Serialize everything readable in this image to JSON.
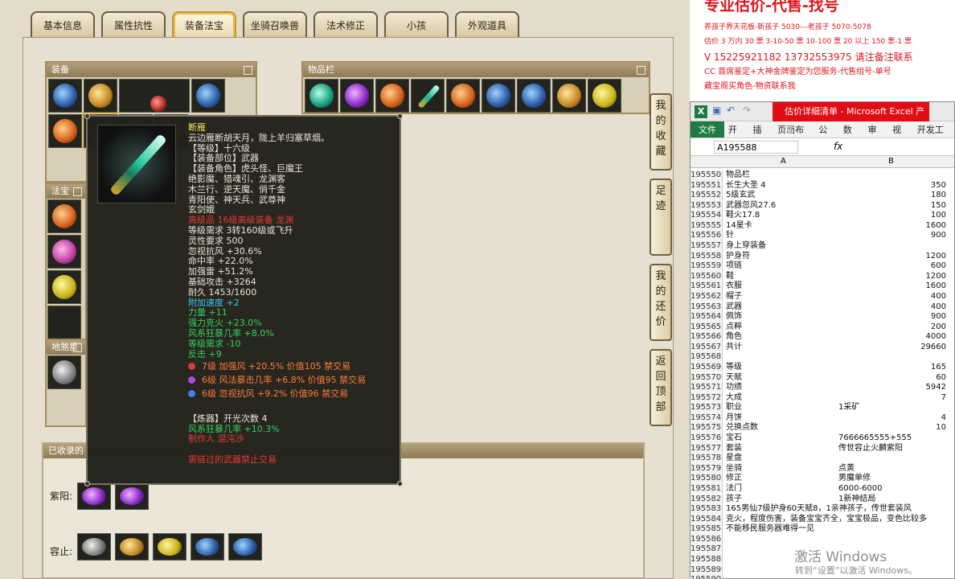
{
  "game": {
    "tabs": [
      {
        "label": "基本信息"
      },
      {
        "label": "属性抗性"
      },
      {
        "label": "装备法宝"
      },
      {
        "label": "坐骑召唤兽"
      },
      {
        "label": "法术修正"
      },
      {
        "label": "小孩"
      },
      {
        "label": "外观道具"
      }
    ],
    "active_tab_index": 2,
    "sections": {
      "equipment": "装备",
      "inventory": "物品栏",
      "treasure": "法宝",
      "earth": "地煞星的",
      "collected": "已收录的"
    },
    "side_buttons": [
      {
        "label": "我的收藏"
      },
      {
        "label": "足迹"
      },
      {
        "label": "我的还价"
      },
      {
        "label": "返回顶部"
      }
    ],
    "collected": {
      "row1_label": "紫阳:",
      "row2_label": "容止:"
    },
    "tooltip": {
      "name": "断雁",
      "desc": "云边雁断胡天月，陇上羊归塞草烟。",
      "level": "【等级】十六级",
      "slot": "【装备部位】武器",
      "roles1": "【装备角色】虎头怪、巨魔王",
      "roles2": "绝影魔、猎魂引、龙渊客",
      "roles3": "木兰行、逆天魔、俏千金",
      "roles4": "青阳使、神天兵、武尊神",
      "roles5": "玄剑娥",
      "warning1": "高级品 16级高级装备 龙渊",
      "req1": "等级需求 3转160级或飞升",
      "req2": "灵性要求 500",
      "stat1": "忽视抗风 +30.6%",
      "stat2": "命中率 +22.0%",
      "stat3": "加强雷 +51.2%",
      "stat4": "基础攻击 +3264",
      "stat5": "耐久 1453/1600",
      "stat6": "附加速度 +2",
      "stat7": "力量 +11",
      "stat8": "强力克火 +23.0%",
      "stat9": "风系狂暴几率 +8.0%",
      "stat10": "等级需求 -10",
      "stat11": "反击 +9",
      "gem1": "7级 加强风 +20.5% 价值105 禁交易",
      "gem2": "6级 风法暴击几率 +6.8% 价值95 禁交易",
      "gem3": "6级 忽视抗风 +9.2% 价值96 禁交易",
      "refine": "【炼器】开光次数 4",
      "refine_stat": "风系狂暴几率 +10.3%",
      "maker": "制作人 混沌沙",
      "footer": "需链过的武器禁止交易"
    }
  },
  "note": {
    "title": "专业估价-代售-找号",
    "line1": "养孩子界天花板-新孩子 5030---老孩子 5070-5078",
    "line2": "估价 3 万内 30 票 3-10-50 票 10-100 票 20 以上 150 票-1 票",
    "line3": "V 15225921182    13732553975   请注备注联系",
    "line4": "CC 首席鉴定+大神金牌鉴定为您服务-代售组号-单号",
    "line5": "藏宝阁买角色-物资联系我"
  },
  "excel": {
    "title": "估价详细清单 - Microsoft Excel 产品",
    "ribbon_tabs": [
      "文件",
      "开始",
      "插入",
      "页面布局",
      "公式",
      "数据",
      "审阅",
      "视图",
      "开发工具"
    ],
    "namebox": "A195588",
    "fx": "fx",
    "col_a": "A",
    "col_b": "B",
    "rows": [
      {
        "n": "195550",
        "a": "物品栏",
        "b": ""
      },
      {
        "n": "195551",
        "a": "长生大圣 4",
        "b": "350"
      },
      {
        "n": "195552",
        "a": "5级玄武",
        "b": "180"
      },
      {
        "n": "195553",
        "a": "武器忽风27.6",
        "b": "150"
      },
      {
        "n": "195554",
        "a": "鞋火17.8",
        "b": "100"
      },
      {
        "n": "195555",
        "a": "14星卡",
        "b": "1600"
      },
      {
        "n": "195556",
        "a": "针",
        "b": "900"
      },
      {
        "n": "195557",
        "a": "身上穿装备",
        "b": ""
      },
      {
        "n": "195558",
        "a": "护身符",
        "b": "1200"
      },
      {
        "n": "195559",
        "a": "项链",
        "b": "600"
      },
      {
        "n": "195560",
        "a": "鞋",
        "b": "1200"
      },
      {
        "n": "195561",
        "a": "衣服",
        "b": "1600"
      },
      {
        "n": "195562",
        "a": "帽子",
        "b": "400"
      },
      {
        "n": "195563",
        "a": "武器",
        "b": "400"
      },
      {
        "n": "195564",
        "a": "佩饰",
        "b": "900"
      },
      {
        "n": "195565",
        "a": "点粹",
        "b": "200"
      },
      {
        "n": "195566",
        "a": "角色",
        "b": "4000"
      },
      {
        "n": "195567",
        "a": "共计",
        "b": "29660"
      },
      {
        "n": "195568",
        "a": "",
        "b": ""
      },
      {
        "n": "195569",
        "a": "等级",
        "b": "165"
      },
      {
        "n": "195570",
        "a": "天赋",
        "b": "60"
      },
      {
        "n": "195571",
        "a": "功绩",
        "b": "5942"
      },
      {
        "n": "195572",
        "a": "大成",
        "b": "7"
      },
      {
        "n": "195573",
        "a": "职业",
        "b": "1采矿",
        "text": true
      },
      {
        "n": "195574",
        "a": "月饼",
        "b": "4"
      },
      {
        "n": "195575",
        "a": "兑换点数",
        "b": "10"
      },
      {
        "n": "195576",
        "a": "宝石",
        "b": "7666665555+555",
        "text": true
      },
      {
        "n": "195577",
        "a": "套装",
        "b": "传世容止火麟紫阳",
        "text": true
      },
      {
        "n": "195578",
        "a": "星盘",
        "b": ""
      },
      {
        "n": "195579",
        "a": "坐骑",
        "b": "点黄",
        "text": true
      },
      {
        "n": "195580",
        "a": "修正",
        "b": "男魔单修",
        "text": true
      },
      {
        "n": "195581",
        "a": "法门",
        "b": "6000-6000",
        "text": true
      },
      {
        "n": "195582",
        "a": "孩子",
        "b": "1新神结局",
        "text": true
      },
      {
        "n": "195583",
        "a": "165男仙7级护身60天赋8，1亲神孩子，传世套装风",
        "b": ""
      },
      {
        "n": "195584",
        "a": "克火，程度伤害，装备宝宝齐全，宝宝极品，变色比较多",
        "b": ""
      },
      {
        "n": "195585",
        "a": "不能移民服务器难得一见",
        "b": ""
      },
      {
        "n": "195586",
        "a": "",
        "b": ""
      },
      {
        "n": "195587",
        "a": "",
        "b": ""
      },
      {
        "n": "195588",
        "a": "",
        "b": ""
      },
      {
        "n": "195589",
        "a": "",
        "b": ""
      },
      {
        "n": "195590",
        "a": "",
        "b": ""
      }
    ]
  },
  "watermark": {
    "line1": "激活 Windows",
    "line2": "转到“设置”以激活 Windows。"
  }
}
